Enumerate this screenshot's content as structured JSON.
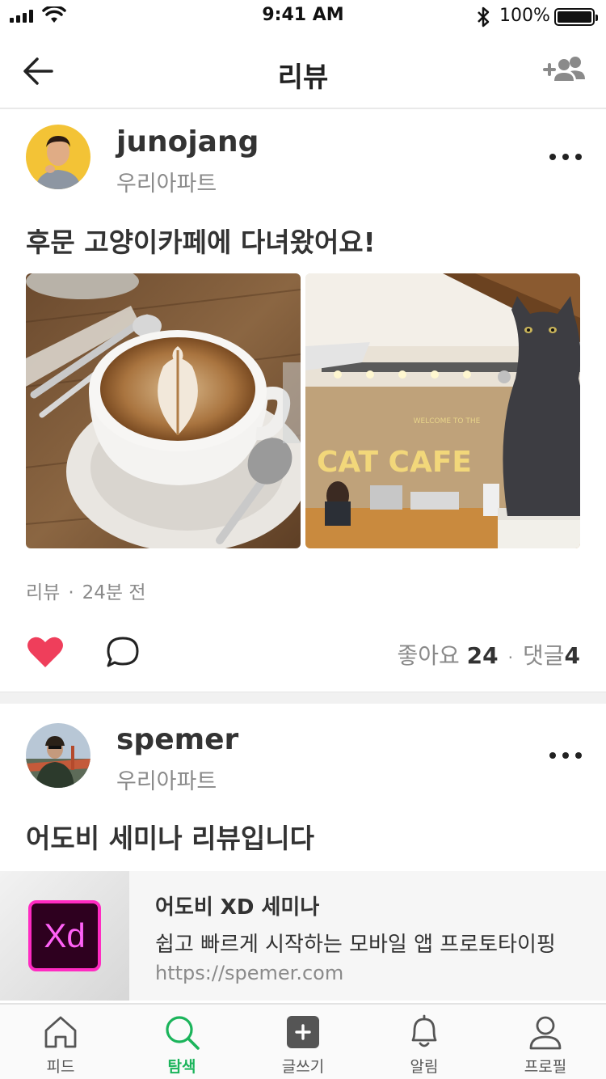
{
  "status_bar": {
    "time": "9:41 AM",
    "battery": "100%"
  },
  "nav": {
    "title": "리뷰",
    "back_icon": "back-arrow-icon",
    "action_icon": "add-friend-icon"
  },
  "posts": [
    {
      "username": "junojang",
      "community": "우리아파트",
      "title": "후문 고양이카페에 다녀왔어요!",
      "category": "리뷰",
      "time": "24분 전",
      "likes_label": "좋아요",
      "likes": "24",
      "comments_label": "댓글",
      "comments": "4",
      "liked": true,
      "photos": [
        "latte-art-photo",
        "cat-cafe-photo"
      ],
      "photo_text": "CAT CAFE",
      "photo_subtext": "WELCOME TO THE"
    },
    {
      "username": "spemer",
      "community": "우리아파트",
      "title": "어도비 세미나 리뷰입니다",
      "link": {
        "logo_text": "Xd",
        "title": "어도비 XD 세미나",
        "description": "쉽고 빠르게 시작하는 모바일 앱 프로토타이핑",
        "url": "https://spemer.com"
      }
    }
  ],
  "tabbar": {
    "tabs": [
      {
        "label": "피드",
        "icon": "home-icon"
      },
      {
        "label": "탐색",
        "icon": "search-icon",
        "active": true
      },
      {
        "label": "글쓰기",
        "icon": "write-icon"
      },
      {
        "label": "알림",
        "icon": "bell-icon"
      },
      {
        "label": "프로필",
        "icon": "profile-icon"
      }
    ]
  },
  "colors": {
    "accent": "#1bb45b",
    "like": "#ef3e5b",
    "text": "#333333",
    "muted": "#8a8a8a"
  }
}
